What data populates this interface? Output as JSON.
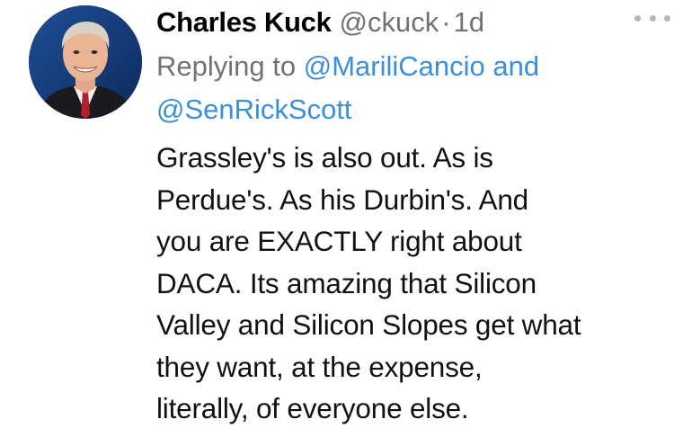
{
  "tweet": {
    "author_name": "Charles Kuck",
    "handle": "@ckuck",
    "separator": "·",
    "timestamp": "1d",
    "replying_prefix": "Replying to",
    "mention_1": "@MariliCancio",
    "replying_conjunction": "and",
    "mention_2": "@SenRickScott",
    "text": "Grassley's is also out.  As is\nPerdue's. As his Durbin's.   And\nyou are EXACTLY right about\nDACA.  Its amazing that Silicon\nValley and Silicon Slopes get what\nthey want, at the expense,\nliterally, of everyone else."
  },
  "icons": {
    "more": "more-horizontal-icon"
  },
  "colors": {
    "mention": "#3b8fd9",
    "secondary_text": "#6e7378",
    "primary_text": "#000000",
    "background": "#ffffff"
  }
}
